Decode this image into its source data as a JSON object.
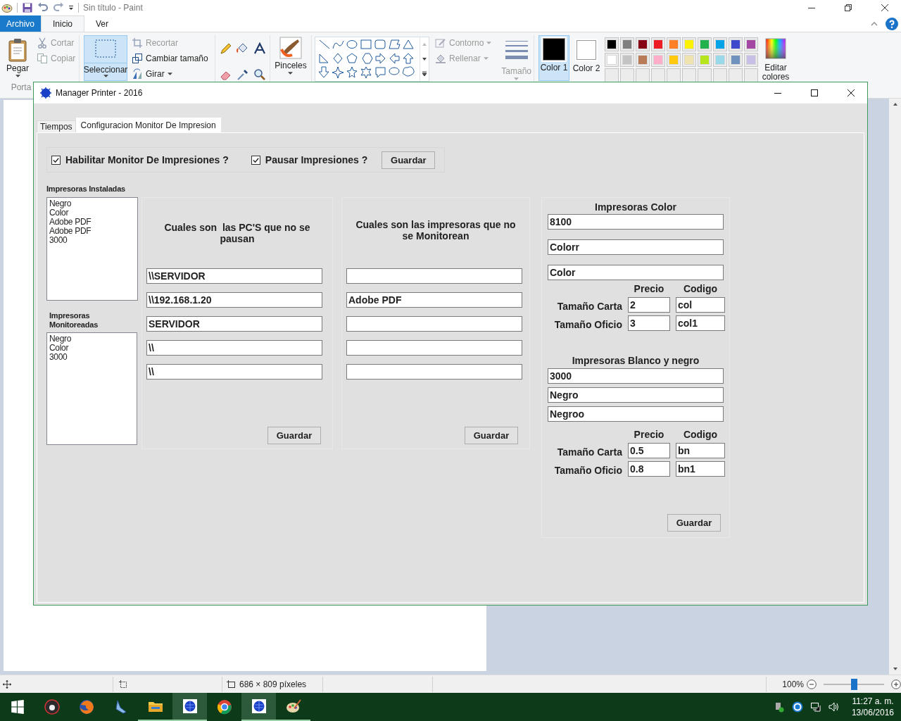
{
  "paint": {
    "title": "Sin título - Paint",
    "menu_tabs": [
      {
        "label": "Archivo",
        "kind": "file",
        "selected": false
      },
      {
        "label": "Inicio",
        "kind": "tab",
        "selected": true
      },
      {
        "label": "Ver",
        "kind": "tab",
        "selected": false
      }
    ],
    "paste": "Pegar",
    "clipboard_tools": [
      {
        "kind": "cut",
        "label": "Cortar",
        "disabled": true
      },
      {
        "kind": "copy",
        "label": "Copiar",
        "disabled": true
      }
    ],
    "clipboard_group": "Porta",
    "select": {
      "label": "Seleccionar",
      "selected": true
    },
    "image_tools": [
      {
        "kind": "crop",
        "label": "Recortar",
        "disabled": true
      },
      {
        "kind": "resize",
        "label": "Cambiar tamaño",
        "disabled": false
      },
      {
        "kind": "rotate",
        "label": "Girar",
        "disabled": false
      }
    ],
    "brushes": "Pinceles",
    "shape_tools": [
      {
        "kind": "outline",
        "label": "Contorno",
        "disabled": true
      },
      {
        "kind": "fill",
        "label": "Rellenar",
        "disabled": true
      }
    ],
    "size": {
      "label": "Tamaño",
      "disabled": true
    },
    "color_slots": [
      {
        "label": "Color 1",
        "color": "#000000",
        "selected": true
      },
      {
        "label": "Color 2",
        "color": "#ffffff",
        "selected": false
      }
    ],
    "palette": [
      {
        "kind": "color",
        "color": "#000000"
      },
      {
        "kind": "color",
        "color": "#7f7f7f"
      },
      {
        "kind": "color",
        "color": "#880015"
      },
      {
        "kind": "color",
        "color": "#ed1c24"
      },
      {
        "kind": "color",
        "color": "#ff7f27"
      },
      {
        "kind": "color",
        "color": "#fff200"
      },
      {
        "kind": "color",
        "color": "#22b14c"
      },
      {
        "kind": "color",
        "color": "#00a2e8"
      },
      {
        "kind": "color",
        "color": "#3f48cc"
      },
      {
        "kind": "color",
        "color": "#a349a4"
      },
      {
        "kind": "color",
        "color": "#ffffff"
      },
      {
        "kind": "color",
        "color": "#c3c3c3"
      },
      {
        "kind": "color",
        "color": "#b97a57"
      },
      {
        "kind": "color",
        "color": "#ffaec9"
      },
      {
        "kind": "color",
        "color": "#ffc90e"
      },
      {
        "kind": "color",
        "color": "#efe4b0"
      },
      {
        "kind": "color",
        "color": "#b5e61d"
      },
      {
        "kind": "color",
        "color": "#99d9ea"
      },
      {
        "kind": "color",
        "color": "#7092be"
      },
      {
        "kind": "color",
        "color": "#c8bfe7"
      },
      {
        "kind": "empty"
      },
      {
        "kind": "empty"
      },
      {
        "kind": "empty"
      },
      {
        "kind": "empty"
      },
      {
        "kind": "empty"
      },
      {
        "kind": "empty"
      },
      {
        "kind": "empty"
      },
      {
        "kind": "empty"
      },
      {
        "kind": "empty"
      },
      {
        "kind": "empty"
      }
    ],
    "edit_colors": "Editar colores",
    "status_bar": {
      "dimensions": "686 × 809 píxeles",
      "zoom": "100%",
      "zoom_slider": {
        "level": 0.5
      }
    }
  },
  "manager": {
    "title": "Manager Printer - 2016",
    "tabs": [
      {
        "label": "Tiempos",
        "selected": false
      },
      {
        "label": "Configuracion Monitor De Impresion",
        "selected": true
      }
    ],
    "options": [
      {
        "label": "Habilitar Monitor De Impresiones ?",
        "checked": true
      },
      {
        "label": "Pausar Impresiones ?",
        "checked": true
      }
    ],
    "options_button": "Guardar",
    "installed": {
      "label": "Impresoras Instaladas",
      "items": [
        "Negro",
        "Color",
        "Adobe PDF",
        "Adobe PDF",
        "3000"
      ]
    },
    "monitored": {
      "label": "Impresoras Monitoreadas",
      "items": [
        "Negro",
        "Color",
        "3000"
      ]
    },
    "excluded_pcs": {
      "heading": "Cuales son  las PC'S que no se pausan",
      "fields": [
        {
          "kind": "filled",
          "value": "\\\\SERVIDOR"
        },
        {
          "kind": "filled",
          "value": "\\\\192.168.1.20"
        },
        {
          "kind": "filled",
          "value": "SERVIDOR"
        },
        {
          "kind": "filled",
          "value": "\\\\"
        },
        {
          "kind": "filled",
          "value": "\\\\"
        }
      ],
      "button": "Guardar"
    },
    "excluded_printers": {
      "heading": "Cuales son las impresoras que no se Monitorean",
      "fields": [
        {
          "kind": "empty"
        },
        {
          "kind": "filled",
          "value": "Adobe PDF"
        },
        {
          "kind": "empty"
        },
        {
          "kind": "empty"
        },
        {
          "kind": "empty"
        }
      ],
      "button": "Guardar"
    },
    "color_printers": {
      "heading": "Impresoras Color",
      "fields": [
        "8100",
        "Colorr",
        "Color"
      ],
      "price_header": "Precio",
      "code_header": "Codigo",
      "rows": [
        {
          "label": "Tamaño Carta",
          "price": "2",
          "code": "col"
        },
        {
          "label": "Tamaño Oficio",
          "price": "3",
          "code": "col1"
        }
      ]
    },
    "bw_printers": {
      "heading": "Impresoras Blanco y negro",
      "fields": [
        "3000",
        "Negro",
        "Negroo"
      ],
      "price_header": "Precio",
      "code_header": "Codigo",
      "rows": [
        {
          "label": "Tamaño Carta",
          "price": "0.5",
          "code": "bn"
        },
        {
          "label": "Tamaño Oficio",
          "price": "0.8",
          "code": "bn1"
        }
      ]
    },
    "prices_button": "Guardar"
  },
  "taskbar": {
    "time": "11:27 a. m.",
    "date": "13/06/2016"
  }
}
